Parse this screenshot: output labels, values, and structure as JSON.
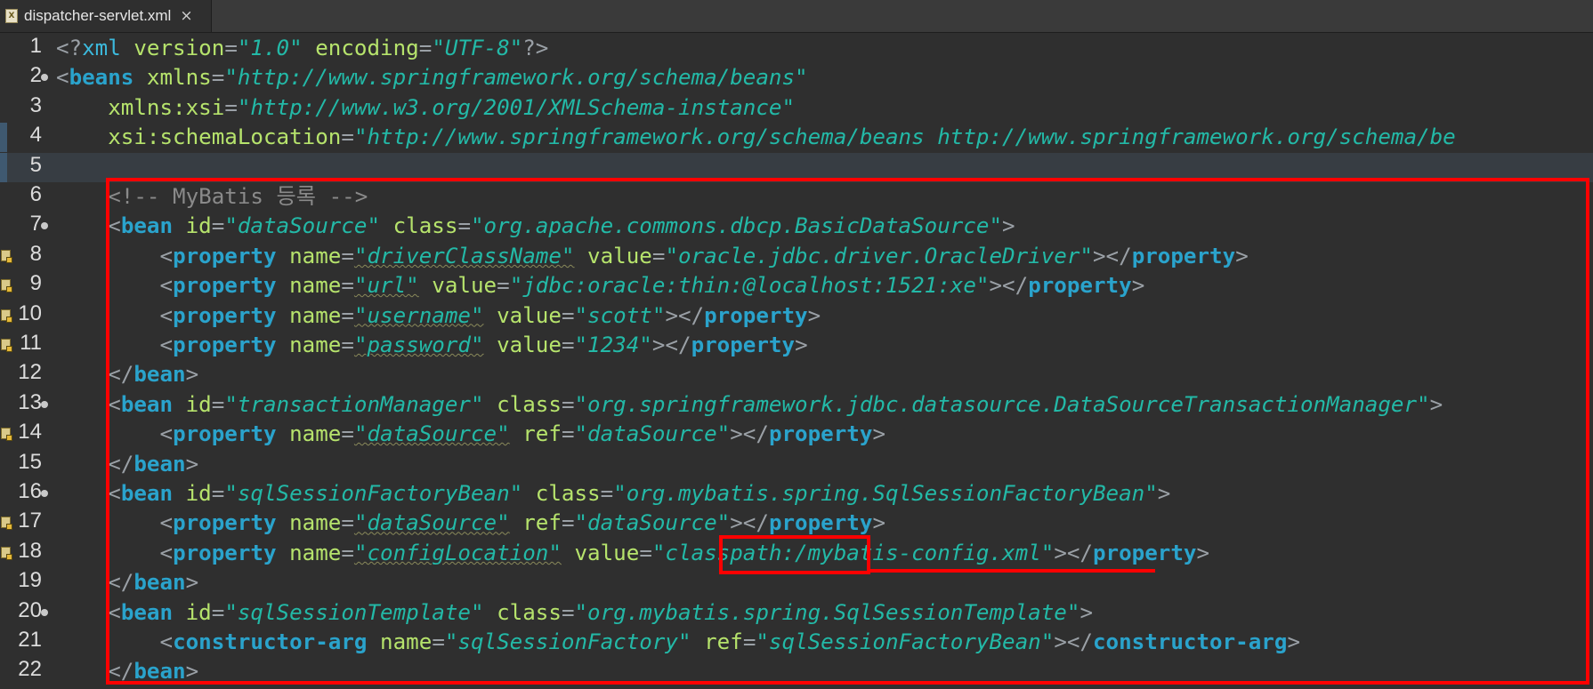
{
  "tab": {
    "title": "dispatcher-servlet.xml",
    "close_glyph": "×",
    "icon_label": "X"
  },
  "colors": {
    "background": "#2f2f2f",
    "tag": "#2aa3cc",
    "attribute": "#b6e36c",
    "value": "#23b9a7",
    "comment": "#8a8a8a",
    "highlight_box": "#ff0000"
  },
  "lines": [
    {
      "n": "1",
      "fold": false,
      "ann": false,
      "tokens": [
        [
          "punc",
          "<?"
        ],
        [
          "decl",
          "xml "
        ],
        [
          "attr",
          "version"
        ],
        [
          "punc",
          "="
        ],
        [
          "val",
          "\"1.0\""
        ],
        [
          "attr",
          " encoding"
        ],
        [
          "punc",
          "="
        ],
        [
          "val",
          "\"UTF-8\""
        ],
        [
          "punc",
          "?>"
        ]
      ]
    },
    {
      "n": "2",
      "fold": true,
      "ann": false,
      "tokens": [
        [
          "punc",
          "<"
        ],
        [
          "tag",
          "beans"
        ],
        [
          "attr",
          " xmlns"
        ],
        [
          "punc",
          "="
        ],
        [
          "val",
          "\"http://www.springframework.org/schema/beans\""
        ]
      ]
    },
    {
      "n": "3",
      "fold": false,
      "ann": false,
      "tokens": [
        [
          "attr",
          "    xmlns:xsi"
        ],
        [
          "punc",
          "="
        ],
        [
          "val",
          "\"http://www.w3.org/2001/XMLSchema-instance\""
        ]
      ]
    },
    {
      "n": "4",
      "fold": false,
      "ann": false,
      "mark": true,
      "tokens": [
        [
          "attr",
          "    xsi:schemaLocation"
        ],
        [
          "punc",
          "="
        ],
        [
          "val",
          "\"http://www.springframework.org/schema/beans http://www.springframework.org/schema/be"
        ]
      ]
    },
    {
      "n": "5",
      "fold": false,
      "ann": false,
      "mark": true,
      "current": true,
      "tokens": []
    },
    {
      "n": "6",
      "fold": false,
      "ann": false,
      "tokens": [
        [
          "comment",
          "    <!-- MyBatis 등록 -->"
        ]
      ]
    },
    {
      "n": "7",
      "fold": true,
      "ann": false,
      "tokens": [
        [
          "punc",
          "    <"
        ],
        [
          "tag",
          "bean"
        ],
        [
          "attr",
          " id"
        ],
        [
          "punc",
          "="
        ],
        [
          "val",
          "\"dataSource\""
        ],
        [
          "attr",
          " class"
        ],
        [
          "punc",
          "="
        ],
        [
          "val",
          "\"org.apache.commons.dbcp.BasicDataSource\""
        ],
        [
          "punc",
          ">"
        ]
      ]
    },
    {
      "n": "8",
      "fold": false,
      "ann": true,
      "tokens": [
        [
          "punc",
          "        <"
        ],
        [
          "tag",
          "property"
        ],
        [
          "attr",
          " name"
        ],
        [
          "punc",
          "="
        ],
        [
          "valw",
          "\"driverClassName\""
        ],
        [
          "attr",
          " value"
        ],
        [
          "punc",
          "="
        ],
        [
          "val",
          "\"oracle.jdbc.driver.OracleDriver\""
        ],
        [
          "punc",
          "></"
        ],
        [
          "tag",
          "property"
        ],
        [
          "punc",
          ">"
        ]
      ]
    },
    {
      "n": "9",
      "fold": false,
      "ann": true,
      "tokens": [
        [
          "punc",
          "        <"
        ],
        [
          "tag",
          "property"
        ],
        [
          "attr",
          " name"
        ],
        [
          "punc",
          "="
        ],
        [
          "valw",
          "\"url\""
        ],
        [
          "attr",
          " value"
        ],
        [
          "punc",
          "="
        ],
        [
          "val",
          "\"jdbc:oracle:thin:@localhost:1521:xe\""
        ],
        [
          "punc",
          "></"
        ],
        [
          "tag",
          "property"
        ],
        [
          "punc",
          ">"
        ]
      ]
    },
    {
      "n": "10",
      "fold": false,
      "ann": true,
      "tokens": [
        [
          "punc",
          "        <"
        ],
        [
          "tag",
          "property"
        ],
        [
          "attr",
          " name"
        ],
        [
          "punc",
          "="
        ],
        [
          "valw",
          "\"username\""
        ],
        [
          "attr",
          " value"
        ],
        [
          "punc",
          "="
        ],
        [
          "val",
          "\"scott\""
        ],
        [
          "punc",
          "></"
        ],
        [
          "tag",
          "property"
        ],
        [
          "punc",
          ">"
        ]
      ]
    },
    {
      "n": "11",
      "fold": false,
      "ann": true,
      "tokens": [
        [
          "punc",
          "        <"
        ],
        [
          "tag",
          "property"
        ],
        [
          "attr",
          " name"
        ],
        [
          "punc",
          "="
        ],
        [
          "valw",
          "\"password\""
        ],
        [
          "attr",
          " value"
        ],
        [
          "punc",
          "="
        ],
        [
          "val",
          "\"1234\""
        ],
        [
          "punc",
          "></"
        ],
        [
          "tag",
          "property"
        ],
        [
          "punc",
          ">"
        ]
      ]
    },
    {
      "n": "12",
      "fold": false,
      "ann": false,
      "tokens": [
        [
          "punc",
          "    </"
        ],
        [
          "tag",
          "bean"
        ],
        [
          "punc",
          ">"
        ]
      ]
    },
    {
      "n": "13",
      "fold": true,
      "ann": false,
      "tokens": [
        [
          "punc",
          "    <"
        ],
        [
          "tag",
          "bean"
        ],
        [
          "attr",
          " id"
        ],
        [
          "punc",
          "="
        ],
        [
          "val",
          "\"transactionManager\""
        ],
        [
          "attr",
          " class"
        ],
        [
          "punc",
          "="
        ],
        [
          "val",
          "\"org.springframework.jdbc.datasource.DataSourceTransactionManager\""
        ],
        [
          "punc",
          ">"
        ]
      ]
    },
    {
      "n": "14",
      "fold": false,
      "ann": true,
      "tokens": [
        [
          "punc",
          "        <"
        ],
        [
          "tag",
          "property"
        ],
        [
          "attr",
          " name"
        ],
        [
          "punc",
          "="
        ],
        [
          "valw",
          "\"dataSource\""
        ],
        [
          "attr",
          " ref"
        ],
        [
          "punc",
          "="
        ],
        [
          "val",
          "\"dataSource\""
        ],
        [
          "punc",
          "></"
        ],
        [
          "tag",
          "property"
        ],
        [
          "punc",
          ">"
        ]
      ]
    },
    {
      "n": "15",
      "fold": false,
      "ann": false,
      "tokens": [
        [
          "punc",
          "    </"
        ],
        [
          "tag",
          "bean"
        ],
        [
          "punc",
          ">"
        ]
      ]
    },
    {
      "n": "16",
      "fold": true,
      "ann": false,
      "tokens": [
        [
          "punc",
          "    <"
        ],
        [
          "tag",
          "bean"
        ],
        [
          "attr",
          " id"
        ],
        [
          "punc",
          "="
        ],
        [
          "val",
          "\"sqlSessionFactoryBean\""
        ],
        [
          "attr",
          " class"
        ],
        [
          "punc",
          "="
        ],
        [
          "val",
          "\"org.mybatis.spring.SqlSessionFactoryBean\""
        ],
        [
          "punc",
          ">"
        ]
      ]
    },
    {
      "n": "17",
      "fold": false,
      "ann": true,
      "tokens": [
        [
          "punc",
          "        <"
        ],
        [
          "tag",
          "property"
        ],
        [
          "attr",
          " name"
        ],
        [
          "punc",
          "="
        ],
        [
          "valw",
          "\"dataSource\""
        ],
        [
          "attr",
          " ref"
        ],
        [
          "punc",
          "="
        ],
        [
          "val",
          "\"dataSource\""
        ],
        [
          "punc",
          "></"
        ],
        [
          "tag",
          "property"
        ],
        [
          "punc",
          ">"
        ]
      ]
    },
    {
      "n": "18",
      "fold": false,
      "ann": true,
      "tokens": [
        [
          "punc",
          "        <"
        ],
        [
          "tag",
          "property"
        ],
        [
          "attr",
          " name"
        ],
        [
          "punc",
          "="
        ],
        [
          "valw",
          "\"configLocation\""
        ],
        [
          "attr",
          " value"
        ],
        [
          "punc",
          "="
        ],
        [
          "val",
          "\"classpath:/mybatis-config.xml\""
        ],
        [
          "punc",
          "></"
        ],
        [
          "tag",
          "property"
        ],
        [
          "punc",
          ">"
        ]
      ]
    },
    {
      "n": "19",
      "fold": false,
      "ann": false,
      "tokens": [
        [
          "punc",
          "    </"
        ],
        [
          "tag",
          "bean"
        ],
        [
          "punc",
          ">"
        ]
      ]
    },
    {
      "n": "20",
      "fold": true,
      "ann": false,
      "tokens": [
        [
          "punc",
          "    <"
        ],
        [
          "tag",
          "bean"
        ],
        [
          "attr",
          " id"
        ],
        [
          "punc",
          "="
        ],
        [
          "val",
          "\"sqlSessionTemplate\""
        ],
        [
          "attr",
          " class"
        ],
        [
          "punc",
          "="
        ],
        [
          "val",
          "\"org.mybatis.spring.SqlSessionTemplate\""
        ],
        [
          "punc",
          ">"
        ]
      ]
    },
    {
      "n": "21",
      "fold": false,
      "ann": false,
      "tokens": [
        [
          "punc",
          "        <"
        ],
        [
          "tag",
          "constructor-arg"
        ],
        [
          "attr",
          " name"
        ],
        [
          "punc",
          "="
        ],
        [
          "val",
          "\"sqlSessionFactory\""
        ],
        [
          "attr",
          " ref"
        ],
        [
          "punc",
          "="
        ],
        [
          "val",
          "\"sqlSessionFactoryBean\""
        ],
        [
          "punc",
          "></"
        ],
        [
          "tag",
          "constructor-arg"
        ],
        [
          "punc",
          ">"
        ]
      ]
    },
    {
      "n": "22",
      "fold": false,
      "ann": false,
      "tokens": [
        [
          "punc",
          "    </"
        ],
        [
          "tag",
          "bean"
        ],
        [
          "punc",
          ">"
        ]
      ]
    }
  ]
}
